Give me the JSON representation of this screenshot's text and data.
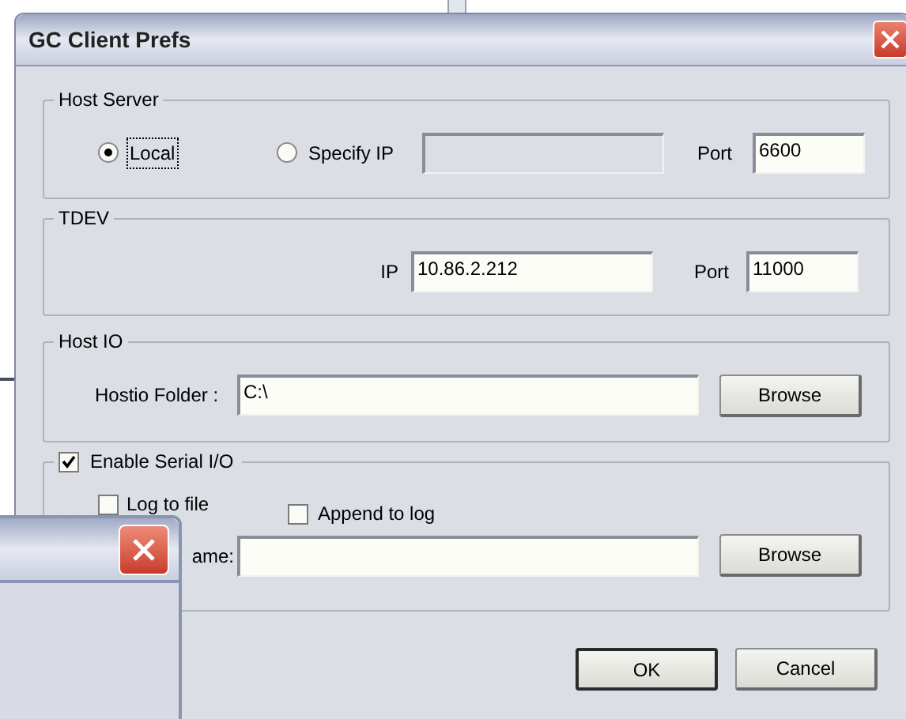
{
  "window": {
    "title": "GC Client Prefs"
  },
  "host_server": {
    "legend": "Host Server",
    "options": [
      {
        "label": "Local",
        "selected": true,
        "focused": true
      },
      {
        "label": "Specify IP",
        "selected": false,
        "focused": false
      }
    ],
    "ip_field": {
      "disabled": true
    },
    "port_label": "Port",
    "port": "6600"
  },
  "tdev": {
    "legend": "TDEV",
    "ip_label": "IP",
    "ip": "10.86.2.212",
    "port_label": "Port",
    "port": "11000"
  },
  "host_io": {
    "legend": "Host IO",
    "folder_label": "Hostio Folder :",
    "folder": "C:\\",
    "button": "Browse"
  },
  "serial": {
    "enable": {
      "label": "Enable Serial I/O",
      "checked": true
    },
    "log_to_file": {
      "label": "Log to file",
      "checked": false
    },
    "append": {
      "label": "Append to log",
      "checked": false
    },
    "file_label": "ame:",
    "button": "Browse"
  },
  "buttons": [
    {
      "label": "OK",
      "default": true
    },
    {
      "label": "Cancel",
      "default": false
    }
  ]
}
